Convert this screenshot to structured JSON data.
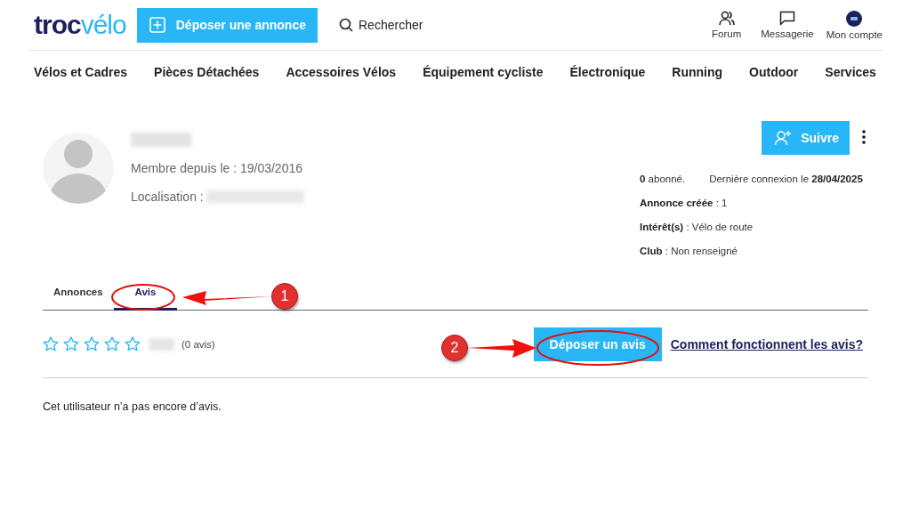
{
  "header": {
    "logo": {
      "first": "troc",
      "second": "vélo"
    },
    "post_button": "Déposer une annonce",
    "search": "Rechercher",
    "links": [
      {
        "label": "Forum",
        "kind": "people"
      },
      {
        "label": "Messagerie",
        "kind": "chat"
      },
      {
        "label": "Mon compte",
        "kind": "avatar"
      }
    ]
  },
  "nav": [
    "Vélos et Cadres",
    "Pièces Détachées",
    "Accessoires Vélos",
    "Équipement cycliste",
    "Électronique",
    "Running",
    "Outdoor",
    "Services"
  ],
  "profile": {
    "member_since": "Membre depuis le : 19/03/2016",
    "location_label": "Localisation :",
    "follow_button": "Suivre",
    "stats": [
      [
        "**0** abonné.",
        "Dernière connexion le **28/04/2025**"
      ],
      [
        "**Annonce créée** : 1"
      ],
      [
        "**Intérêt(s)** : Vélo de route"
      ],
      [
        "**Club** : Non renseigné"
      ]
    ]
  },
  "tabs": [
    {
      "label": "Annonces",
      "selected": false
    },
    {
      "label": "Avis",
      "selected": true
    }
  ],
  "reviews": {
    "stars": 0,
    "count": "(0 avis)",
    "post_button": "Déposer un avis",
    "help_link": "Comment fonctionnent les avis?",
    "empty_message": "Cet utilisateur n’a pas encore d’avis."
  },
  "annotations": [
    {
      "number": "1"
    },
    {
      "number": "2"
    }
  ]
}
